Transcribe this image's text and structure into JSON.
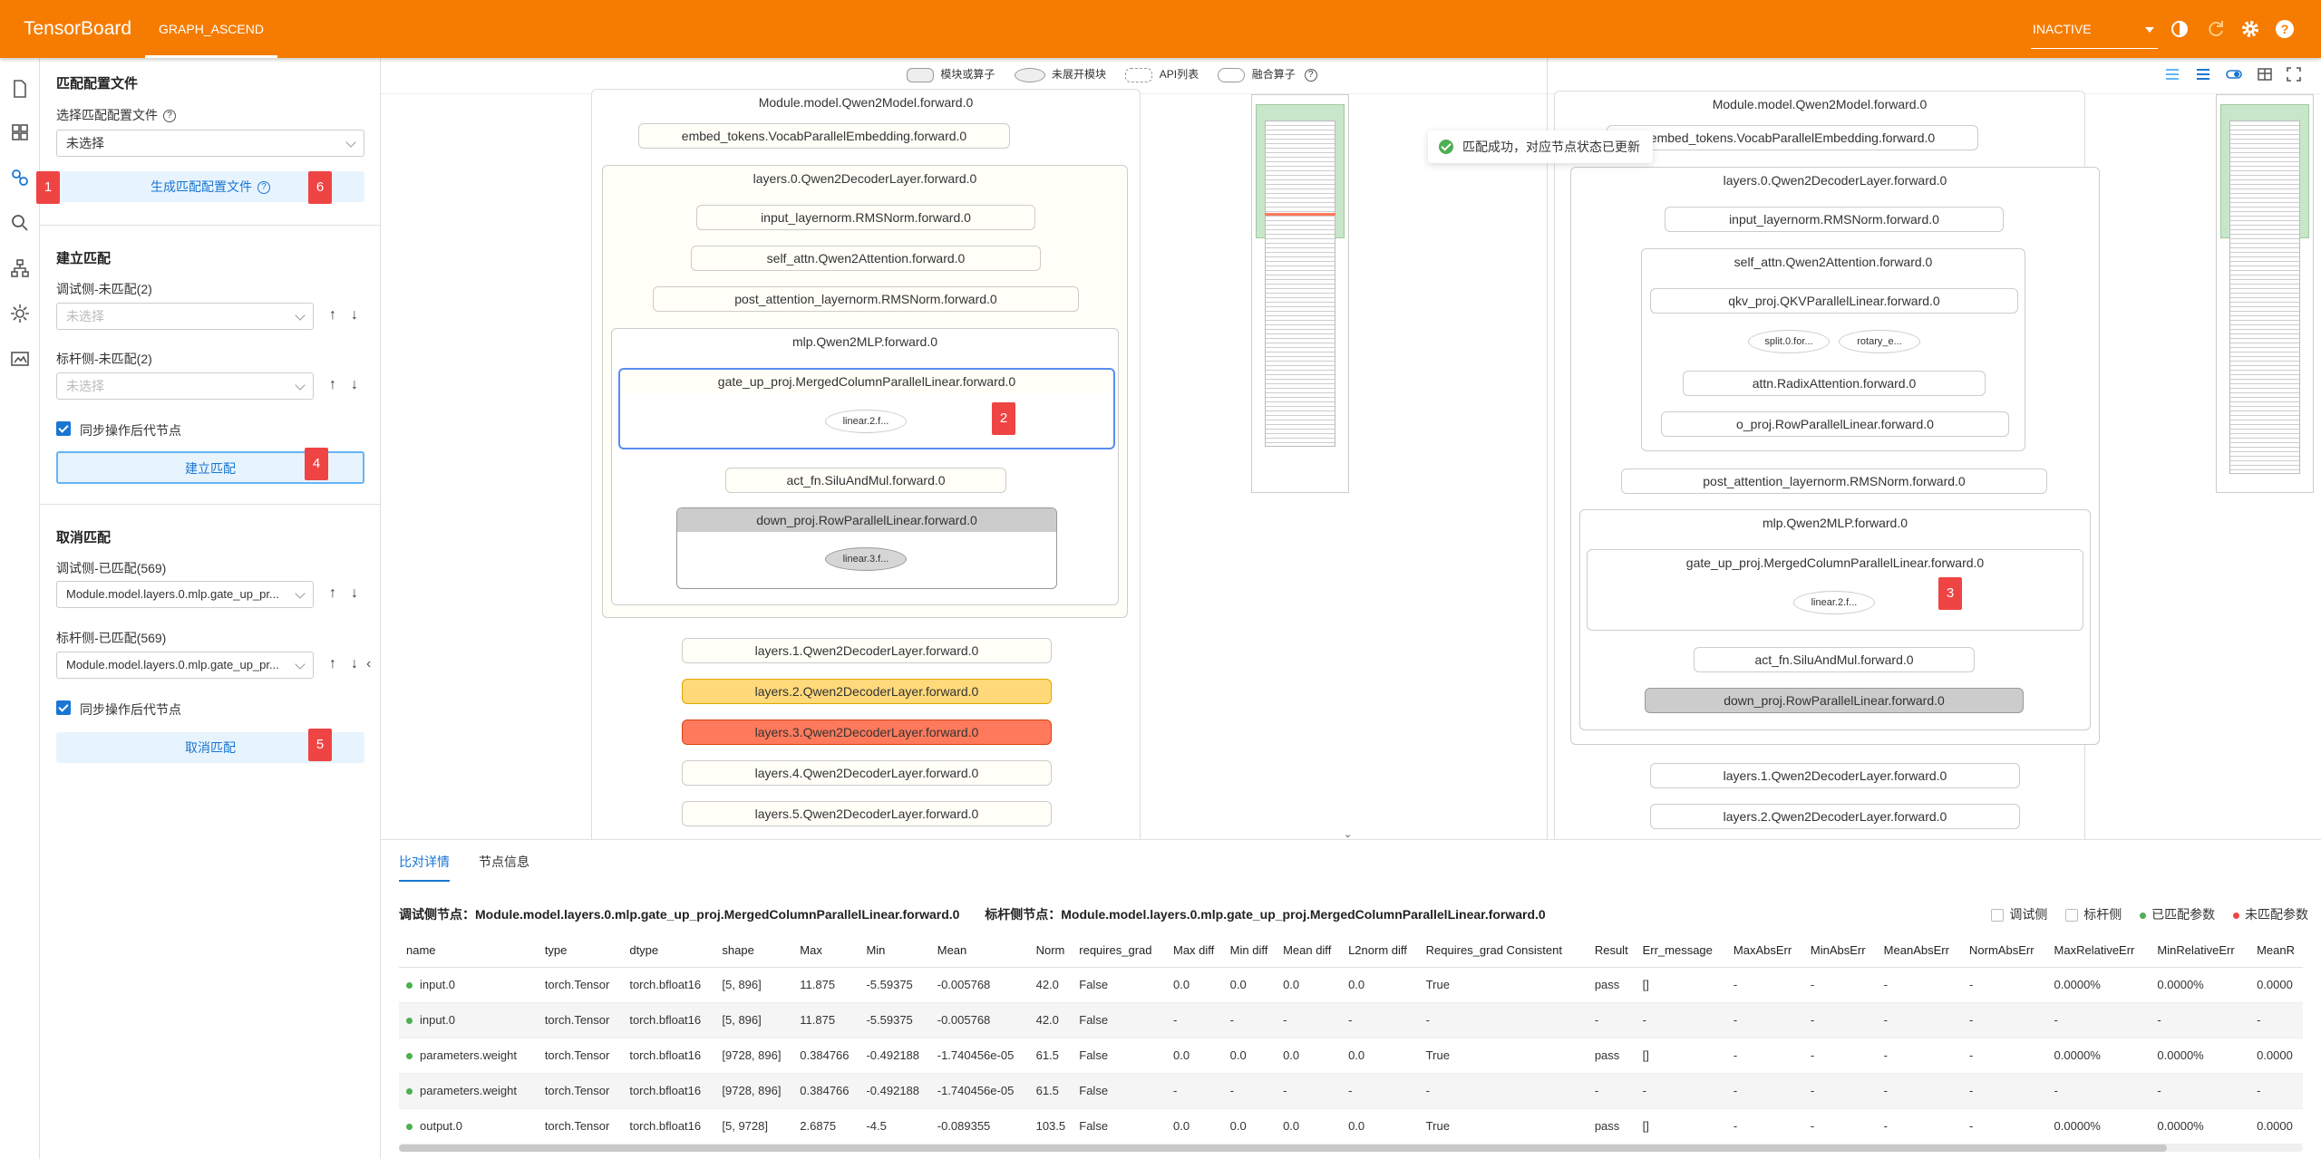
{
  "app": {
    "brand": "TensorBoard",
    "tab": "GRAPH_ASCEND",
    "run_select": "INACTIVE"
  },
  "sidebar": {
    "match_config": {
      "title": "匹配配置文件",
      "select_label": "选择匹配配置文件",
      "select_value": "未选择",
      "generate_button": "生成匹配配置文件"
    },
    "build_match": {
      "title": "建立匹配",
      "debug_label": "调试侧-未匹配(2)",
      "debug_placeholder": "未选择",
      "bench_label": "标杆侧-未匹配(2)",
      "bench_placeholder": "未选择",
      "sync_label": "同步操作后代节点",
      "button": "建立匹配"
    },
    "cancel_match": {
      "title": "取消匹配",
      "debug_label": "调试侧-已匹配(569)",
      "debug_value": "Module.model.layers.0.mlp.gate_up_pr...",
      "bench_label": "标杆侧-已匹配(569)",
      "bench_value": "Module.model.layers.0.mlp.gate_up_pr...",
      "sync_label": "同步操作后代节点",
      "button": "取消匹配"
    }
  },
  "badges": [
    "1",
    "2",
    "3",
    "4",
    "5",
    "6"
  ],
  "legend": {
    "module": "模块或算子",
    "unexpanded": "未展开模块",
    "apis": "API列表",
    "fusion": "融合算子"
  },
  "toast": "匹配成功，对应节点状态已更新",
  "left_graph": {
    "root": "Module.model.Qwen2Model.forward.0",
    "embed": "embed_tokens.VocabParallelEmbedding.forward.0",
    "layer0": "layers.0.Qwen2DecoderLayer.forward.0",
    "input_norm": "input_layernorm.RMSNorm.forward.0",
    "self_attn": "self_attn.Qwen2Attention.forward.0",
    "post_norm": "post_attention_layernorm.RMSNorm.forward.0",
    "mlp": "mlp.Qwen2MLP.forward.0",
    "gate_up": "gate_up_proj.MergedColumnParallelLinear.forward.0",
    "gate_up_child": "linear.2.f...",
    "act_fn": "act_fn.SiluAndMul.forward.0",
    "down_proj": "down_proj.RowParallelLinear.forward.0",
    "down_child": "linear.3.f...",
    "layers": [
      "layers.1.Qwen2DecoderLayer.forward.0",
      "layers.2.Qwen2DecoderLayer.forward.0",
      "layers.3.Qwen2DecoderLayer.forward.0",
      "layers.4.Qwen2DecoderLayer.forward.0",
      "layers.5.Qwen2DecoderLayer.forward.0"
    ]
  },
  "right_graph": {
    "root": "Module.model.Qwen2Model.forward.0",
    "embed": "embed_tokens.VocabParallelEmbedding.forward.0",
    "layer0": "layers.0.Qwen2DecoderLayer.forward.0",
    "input_norm": "input_layernorm.RMSNorm.forward.0",
    "self_attn": "self_attn.Qwen2Attention.forward.0",
    "qkv": "qkv_proj.QKVParallelLinear.forward.0",
    "split": "split.0.for...",
    "rotary": "rotary_e...",
    "attn": "attn.RadixAttention.forward.0",
    "o_proj": "o_proj.RowParallelLinear.forward.0",
    "post_norm": "post_attention_layernorm.RMSNorm.forward.0",
    "mlp": "mlp.Qwen2MLP.forward.0",
    "gate_up": "gate_up_proj.MergedColumnParallelLinear.forward.0",
    "gate_up_child": "linear.2.f...",
    "act_fn": "act_fn.SiluAndMul.forward.0",
    "down_proj": "down_proj.RowParallelLinear.forward.0",
    "layers": [
      "layers.1.Qwen2DecoderLayer.forward.0",
      "layers.2.Qwen2DecoderLayer.forward.0"
    ]
  },
  "bottom": {
    "tabs": [
      "比对详情",
      "节点信息"
    ],
    "debug_node_label": "调试侧节点：",
    "debug_node": "Module.model.layers.0.mlp.gate_up_proj.MergedColumnParallelLinear.forward.0",
    "bench_node_label": "标杆侧节点：",
    "bench_node": "Module.model.layers.0.mlp.gate_up_proj.MergedColumnParallelLinear.forward.0",
    "legend": {
      "debug": "调试侧",
      "bench": "标杆侧",
      "matched": "已匹配参数",
      "unmatched": "未匹配参数"
    },
    "columns": [
      "name",
      "type",
      "dtype",
      "shape",
      "Max",
      "Min",
      "Mean",
      "Norm",
      "requires_grad",
      "Max diff",
      "Min diff",
      "Mean diff",
      "L2norm diff",
      "Requires_grad Consistent",
      "Result",
      "Err_message",
      "MaxAbsErr",
      "MinAbsErr",
      "MeanAbsErr",
      "NormAbsErr",
      "MaxRelativeErr",
      "MinRelativeErr",
      "MeanR"
    ],
    "rows": [
      [
        "input.0",
        "torch.Tensor",
        "torch.bfloat16",
        "[5, 896]",
        "11.875",
        "-5.59375",
        "-0.005768",
        "42.0",
        "False",
        "0.0",
        "0.0",
        "0.0",
        "0.0",
        "True",
        "pass",
        "[]",
        "-",
        "-",
        "-",
        "-",
        "0.0000%",
        "0.0000%",
        "0.0000"
      ],
      [
        "input.0",
        "torch.Tensor",
        "torch.bfloat16",
        "[5, 896]",
        "11.875",
        "-5.59375",
        "-0.005768",
        "42.0",
        "False",
        "-",
        "-",
        "-",
        "-",
        "-",
        "-",
        "-",
        "-",
        "-",
        "-",
        "-",
        "-",
        "-",
        "-"
      ],
      [
        "parameters.weight",
        "torch.Tensor",
        "torch.bfloat16",
        "[9728, 896]",
        "0.384766",
        "-0.492188",
        "-1.740456e-05",
        "61.5",
        "False",
        "0.0",
        "0.0",
        "0.0",
        "0.0",
        "True",
        "pass",
        "[]",
        "-",
        "-",
        "-",
        "-",
        "0.0000%",
        "0.0000%",
        "0.0000"
      ],
      [
        "parameters.weight",
        "torch.Tensor",
        "torch.bfloat16",
        "[9728, 896]",
        "0.384766",
        "-0.492188",
        "-1.740456e-05",
        "61.5",
        "False",
        "-",
        "-",
        "-",
        "-",
        "-",
        "-",
        "-",
        "-",
        "-",
        "-",
        "-",
        "-",
        "-",
        "-"
      ],
      [
        "output.0",
        "torch.Tensor",
        "torch.bfloat16",
        "[5, 9728]",
        "2.6875",
        "-4.5",
        "-0.089355",
        "103.5",
        "False",
        "0.0",
        "0.0",
        "0.0",
        "0.0",
        "True",
        "pass",
        "[]",
        "-",
        "-",
        "-",
        "-",
        "0.0000%",
        "0.0000%",
        "0.0000"
      ]
    ]
  },
  "colors": {
    "brand": "#f57c00",
    "accent": "#1976d2",
    "badge": "#ef4444",
    "match_ok": "#4caf50"
  }
}
